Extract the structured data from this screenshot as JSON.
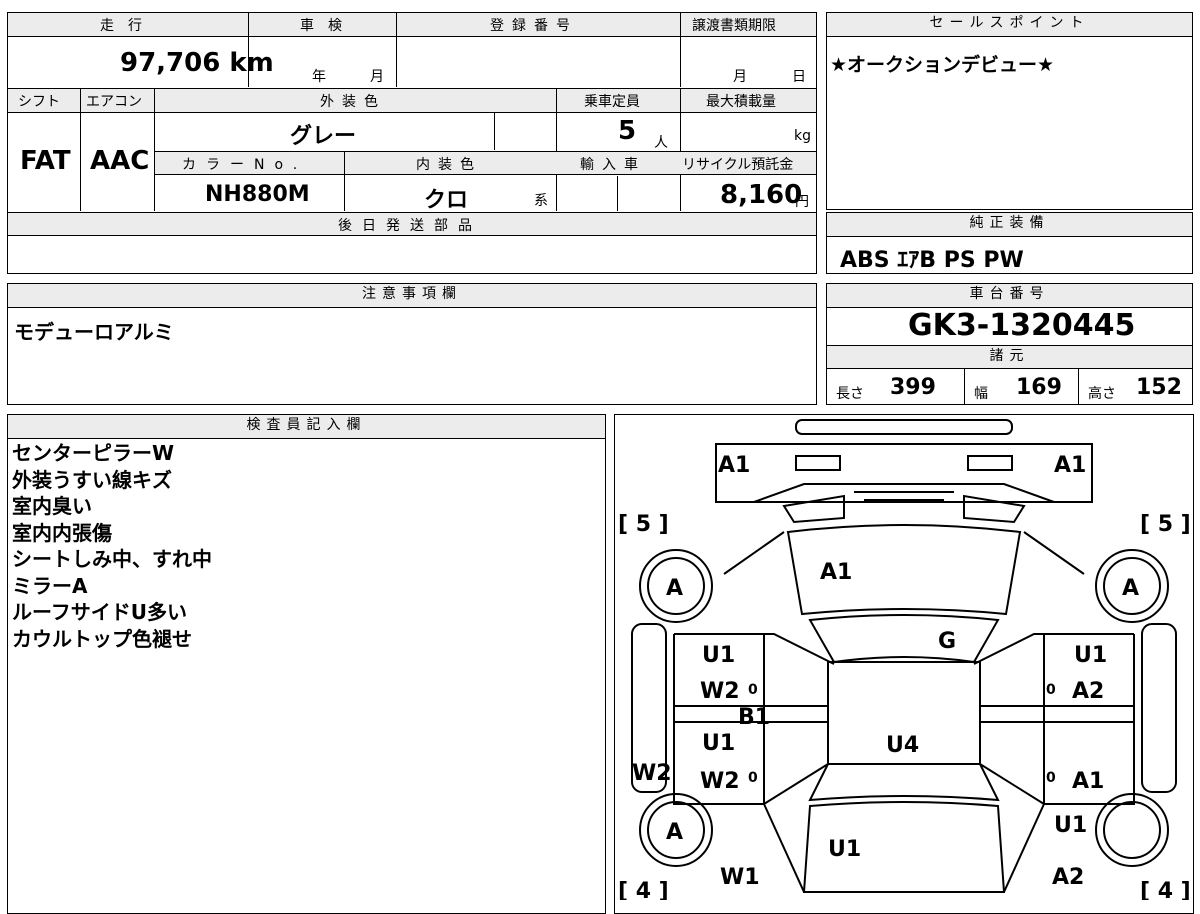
{
  "top": {
    "headers": {
      "mileage": "走　行",
      "inspection": "車　検",
      "registration": "登録番号",
      "transfer_deadline": "譲渡書類期限"
    },
    "mileage": "97,706 km",
    "inspection_year": "年",
    "inspection_month": "月",
    "deadline_month": "月",
    "deadline_day": "日"
  },
  "spec": {
    "headers": {
      "shift": "シフト",
      "aircon": "エアコン",
      "exterior_color": "外装色",
      "capacity": "乗車定員",
      "max_load": "最大積載量",
      "color_no": "カラーNo.",
      "interior_color": "内装色",
      "import": "輸入車",
      "recycle": "リサイクル預託金"
    },
    "shift": "FAT",
    "aircon": "AAC",
    "exterior_color": "グレー",
    "capacity": "5",
    "capacity_unit": "人",
    "load_unit": "kg",
    "color_no": "NH880M",
    "interior_color": "クロ",
    "interior_suffix": "系",
    "recycle_fee": "8,160",
    "recycle_unit": "円"
  },
  "later_parts": {
    "header": "後日発送部品",
    "value": ""
  },
  "sales_point": {
    "header": "セールスポイント",
    "text": "★オークションデビュー★"
  },
  "equipment": {
    "header": "純正装備",
    "text": "ABS ｴｱB PS PW"
  },
  "notes": {
    "header": "注意事項欄",
    "text": "モデューロアルミ"
  },
  "chassis": {
    "header": "車台番号",
    "number": "GK3-1320445"
  },
  "dimensions": {
    "header": "諸元",
    "length_label": "長さ",
    "length": "399",
    "width_label": "幅",
    "width": "169",
    "height_label": "高さ",
    "height": "152"
  },
  "inspector": {
    "header": "検査員記入欄",
    "lines": [
      "センターピラーW",
      "外装うすい線キズ",
      "室内臭い",
      "室内内張傷",
      "シートしみ中、すれ中",
      "ミラーA",
      "ルーフサイドU多い",
      "カウルトップ色褪せ"
    ]
  },
  "diagram": {
    "labels": {
      "front_left": "A1",
      "front_right": "A1",
      "bonnet": "A1",
      "windshield": "G",
      "fender_l_top": "[ 5 ]",
      "fender_r_top": "[ 5 ]",
      "fender_l_bot": "[ 4 ]",
      "fender_r_bot": "[ 4 ]",
      "wheel": "A",
      "l_door1_a": "U1",
      "l_door1_b": "W2",
      "l_pillar": "B1",
      "l_door2_a": "U1",
      "l_door2_b": "W2",
      "l_sill": "W2",
      "l_rear": "W1",
      "r_door1_a": "U1",
      "r_door1_b": "A2",
      "r_door2_a": "A1",
      "r_qtr": "U1",
      "r_rear": "A2",
      "roof": "U4",
      "trunk": "U1",
      "zero": "0"
    }
  }
}
